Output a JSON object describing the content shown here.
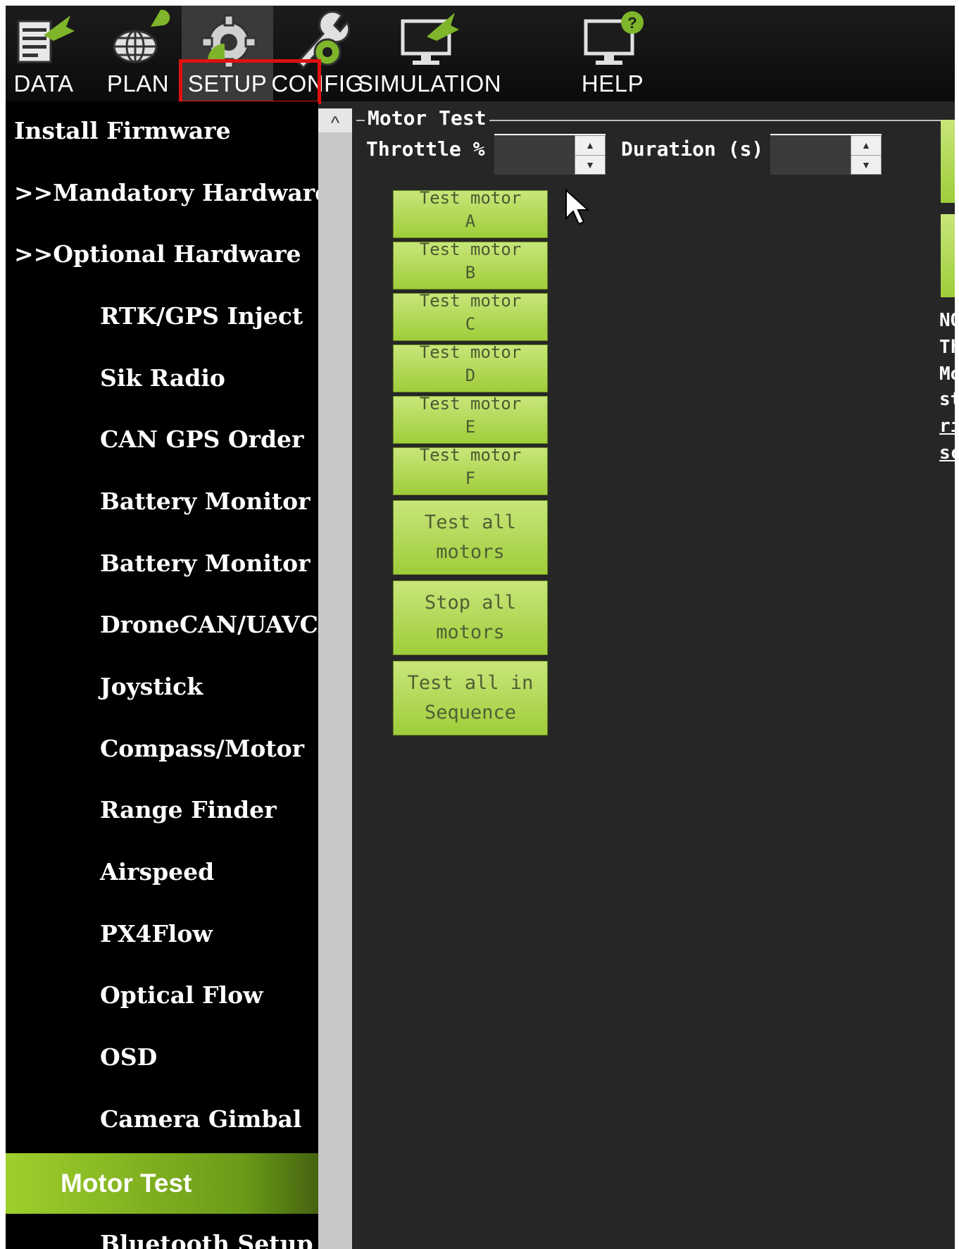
{
  "toolbar": {
    "items": [
      {
        "label": "DATA",
        "icon": "data-icon"
      },
      {
        "label": "PLAN",
        "icon": "plan-globe-icon"
      },
      {
        "label": "SETUP",
        "icon": "setup-gear-icon"
      },
      {
        "label": "CONFIG",
        "icon": "config-wrench-icon"
      },
      {
        "label": "SIMULATION",
        "icon": "simulation-monitor-icon"
      },
      {
        "label": "HELP",
        "icon": "help-monitor-icon"
      }
    ],
    "active": "SETUP",
    "highlight_color": "#e01010"
  },
  "sidebar": {
    "items": [
      {
        "label": "Install Firmware"
      },
      {
        "label": ">>Mandatory Hardware"
      },
      {
        "label": ">>Optional Hardware"
      },
      {
        "label": "RTK/GPS Inject"
      },
      {
        "label": "Sik Radio"
      },
      {
        "label": "CAN GPS Order"
      },
      {
        "label": "Battery Monitor"
      },
      {
        "label": "Battery Monitor"
      },
      {
        "label": "DroneCAN/UAVCAN"
      },
      {
        "label": "Joystick"
      },
      {
        "label": "Compass/Motor"
      },
      {
        "label": "Range Finder"
      },
      {
        "label": "Airspeed"
      },
      {
        "label": "PX4Flow"
      },
      {
        "label": "Optical Flow"
      },
      {
        "label": "OSD"
      },
      {
        "label": "Camera Gimbal"
      },
      {
        "label": "Motor Test"
      },
      {
        "label": "Bluetooth Setup"
      }
    ],
    "selected": "Motor Test",
    "accent": "#8cc63f"
  },
  "motor_test": {
    "group_title": "Motor Test",
    "throttle_label": "Throttle %",
    "throttle_value": "",
    "duration_label": "Duration (s)",
    "duration_value": "",
    "buttons": [
      {
        "line1": "Test motor",
        "line2": "A"
      },
      {
        "line1": "Test motor",
        "line2": "B"
      },
      {
        "line1": "Test motor",
        "line2": "C"
      },
      {
        "line1": "Test motor",
        "line2": "D"
      },
      {
        "line1": "Test motor",
        "line2": "E"
      },
      {
        "line1": "Test motor",
        "line2": "F"
      }
    ],
    "big_buttons": [
      {
        "line1": "Test all",
        "line2": "motors"
      },
      {
        "line1": "Stop all",
        "line2": "motors"
      },
      {
        "line1": "Test all in",
        "line2": "Sequence"
      }
    ],
    "right_notes": [
      "NO",
      "Th",
      "Mo",
      "st",
      "ri",
      "sc"
    ]
  }
}
